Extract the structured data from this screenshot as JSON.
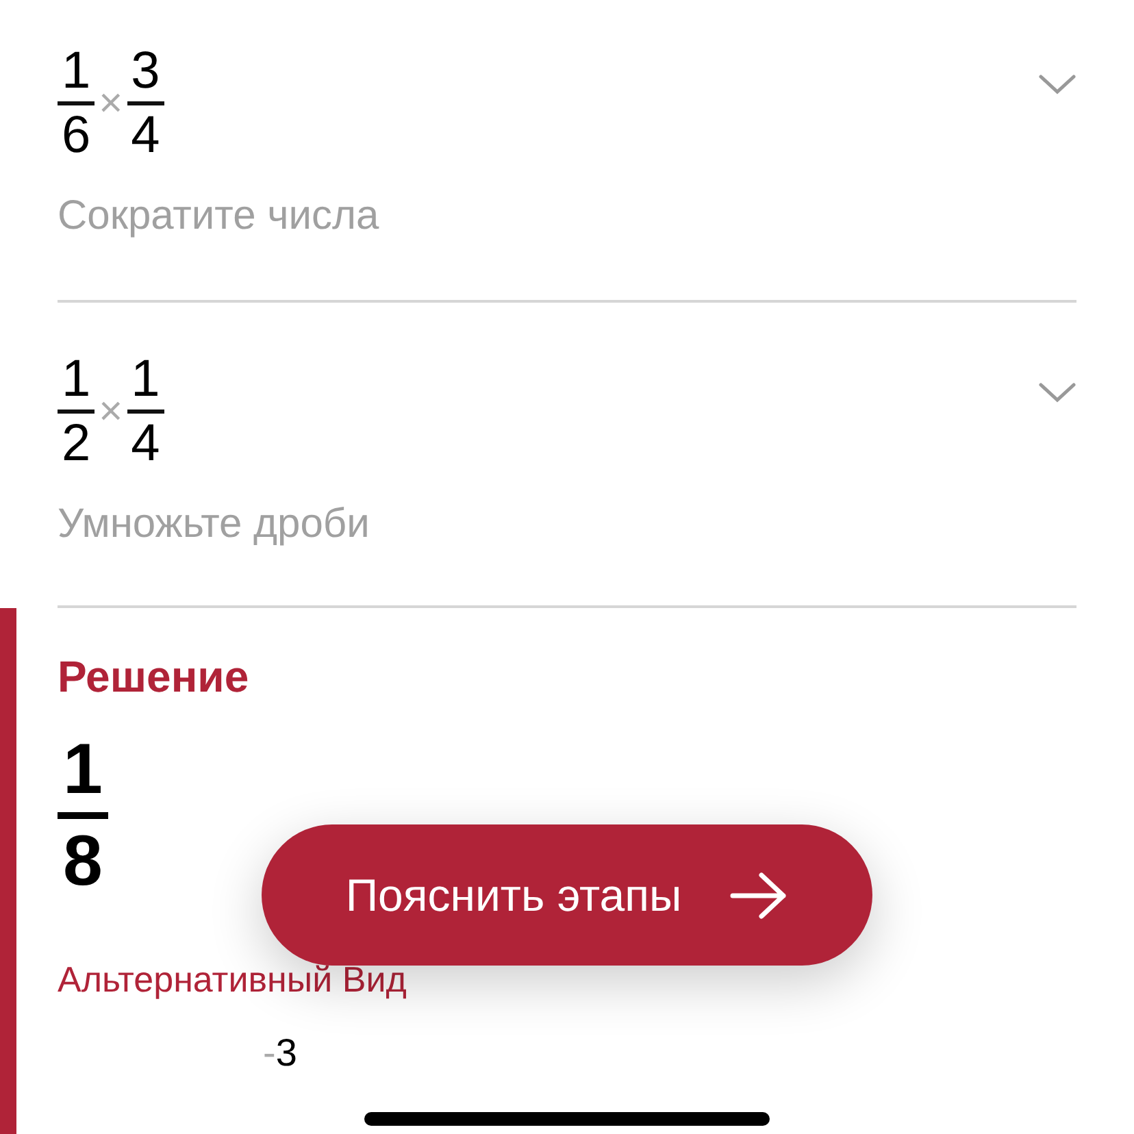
{
  "steps": [
    {
      "terms": [
        {
          "numerator": "1",
          "denominator": "6"
        },
        {
          "numerator": "3",
          "denominator": "4"
        }
      ],
      "operator": "×",
      "caption": "Сократите числа",
      "expanded": false
    },
    {
      "terms": [
        {
          "numerator": "1",
          "denominator": "2"
        },
        {
          "numerator": "1",
          "denominator": "4"
        }
      ],
      "operator": "×",
      "caption": "Умножьте дроби",
      "expanded": false
    }
  ],
  "solution": {
    "heading": "Решение",
    "result": {
      "numerator": "1",
      "denominator": "8"
    },
    "alternative_heading": "Альтернативный Вид",
    "alternative_exponent": {
      "sign": "-",
      "value": "3"
    }
  },
  "explain_button": {
    "label": "Пояснить этапы"
  }
}
